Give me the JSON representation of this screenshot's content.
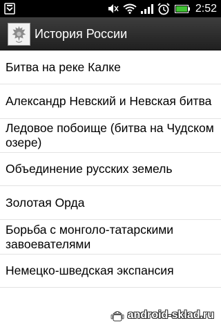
{
  "status_bar": {
    "time": "2:52",
    "icons": [
      "notification-icon",
      "mute-icon",
      "wifi-icon",
      "signal-icon",
      "alarm-icon",
      "battery-icon"
    ]
  },
  "title_bar": {
    "title": "История России",
    "icon": "coat-of-arms-icon"
  },
  "topics": [
    "Битва на реке Калке",
    "Александр Невский и Невская битва",
    "Ледовое побоище (битва на Чудском озере)",
    "Объединение русских земель",
    "Золотая Орда",
    "Борьба с монголо-татарскими завоевателями",
    "Немецко-шведская экспансия"
  ],
  "watermark": {
    "text": "android-sklad.ru",
    "icon": "android-robot-icon"
  },
  "colors": {
    "status_bar": "#000000",
    "title_bar": "#2e2e2e",
    "list_background": "#ffffff",
    "divider": "#e3e3e3",
    "text": "#000000"
  }
}
